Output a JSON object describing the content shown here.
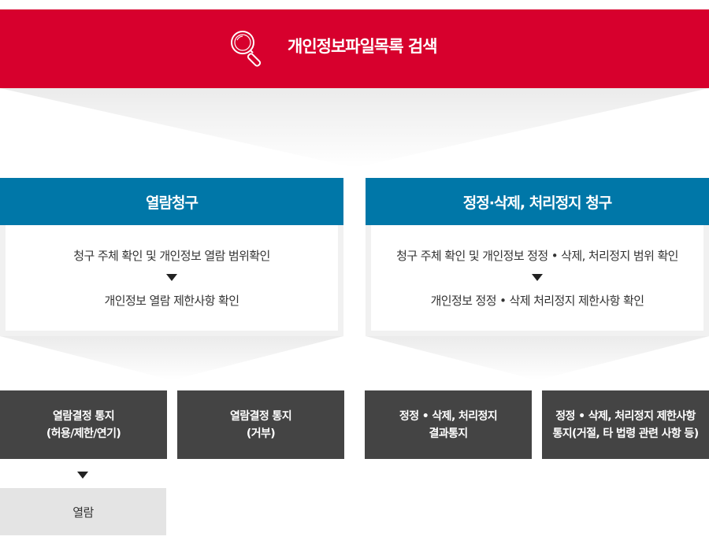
{
  "banner": {
    "title": "개인정보파일목록 검색",
    "icon": "search-icon",
    "color": "#d7002d"
  },
  "left_column": {
    "title": "열람청구",
    "step1": "청구 주체 확인 및 개인정보 열람 범위확인",
    "step2": "개인정보 열람 제한사항 확인",
    "color": "#0077a8"
  },
  "right_column": {
    "title": "정정·삭제, 처리정지 청구",
    "step1": "청구 주체 확인 및 개인정보 정정 • 삭제, 처리정지 범위 확인",
    "step2": "개인정보 정정 • 삭제 처리정지 제한사항 확인",
    "color": "#0077a8"
  },
  "results": {
    "box1": {
      "line1": "열람결정 통지",
      "line2": "(허용/제한/연기)"
    },
    "box2": {
      "line1": "열람결정 통지",
      "line2": "(거부)"
    },
    "box3": {
      "line1": "정정 • 삭제, 처리정지",
      "line2": "결과통지"
    },
    "box4": {
      "line1": "정정 • 삭제, 처리정지 제한사항",
      "line2": "통지(거절, 타 법령 관련 사항 등)"
    },
    "color": "#444444"
  },
  "final": {
    "label": "열람"
  }
}
